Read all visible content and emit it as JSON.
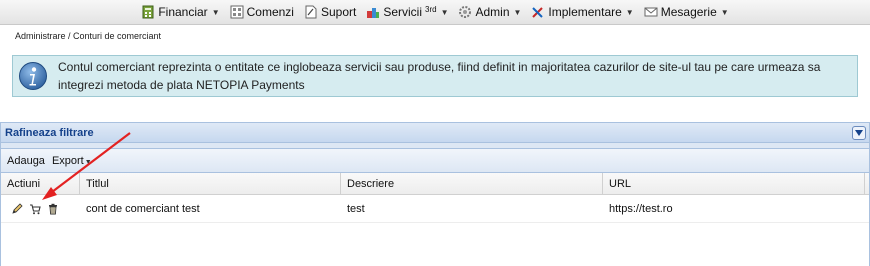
{
  "nav": {
    "items": [
      {
        "label": "Financiar",
        "icon": "calculator-icon",
        "dropdown": true
      },
      {
        "label": "Comenzi",
        "icon": "orders-icon",
        "dropdown": false
      },
      {
        "label": "Suport",
        "icon": "document-icon",
        "dropdown": false
      },
      {
        "label": "Servicii",
        "sup": "3rd",
        "icon": "puzzle-icon",
        "dropdown": true
      },
      {
        "label": "Admin",
        "icon": "gear-icon",
        "dropdown": true
      },
      {
        "label": "Implementare",
        "icon": "tools-icon",
        "dropdown": true
      },
      {
        "label": "Mesagerie",
        "icon": "envelope-icon",
        "dropdown": true
      }
    ]
  },
  "breadcrumb": "Administrare / Conturi de comerciant",
  "info": {
    "line1": "Contul comerciant reprezinta o entitate ce inglobeaza servicii sau produse, fiind definit in majoritatea cazurilor de site-ul tau pe care urmeaza sa",
    "line2": "integrezi metoda de plata NETOPIA Payments"
  },
  "panel": {
    "title": "Rafineaza filtrare"
  },
  "toolbar": {
    "add_label": "Adauga",
    "export_label": "Export"
  },
  "table": {
    "columns": [
      "Actiuni",
      "Titlul",
      "Descriere",
      "URL"
    ],
    "rows": [
      {
        "title": "cont de comerciant test",
        "description": "test",
        "url": "https://test.ro"
      }
    ]
  },
  "colors": {
    "info_bg": "#d6ecf0",
    "panel_title": "#15428b",
    "arrow": "#e32222"
  }
}
